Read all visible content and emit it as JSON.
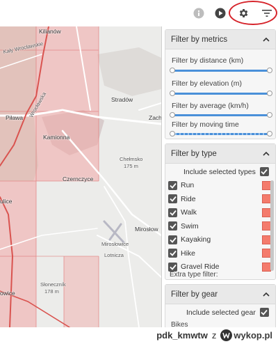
{
  "toolbar": {
    "icons": [
      "info-icon",
      "play-icon",
      "gear-icon",
      "filter-icon"
    ]
  },
  "map": {
    "labels": {
      "kilianow": "Kilianów",
      "kaly": "Kały Wrocławskie",
      "wroclawska": "Wrocławska",
      "pilawa": "Piława",
      "kamionna": "Kamionna",
      "stradow": "Stradów",
      "zach": "Zach",
      "chelmsko": "Chełmsko",
      "chelmsko_elev": "175 m",
      "czernczyce": "Czernczyce",
      "ulice": "ulice",
      "mirostowice_airport": "Mirosłowice",
      "mirostowice": "Mirosłow",
      "lotnicza": "Lotnicza",
      "sloneczník": "Słoneczník",
      "sloneczník_elev": "178 m",
      "owice": "owice"
    }
  },
  "filters": {
    "metrics": {
      "title": "Filter by metrics",
      "items": [
        {
          "label": "Filter by distance (km)"
        },
        {
          "label": "Filter by elevation (m)"
        },
        {
          "label": "Filter by average (km/h)"
        },
        {
          "label": "Filter by moving time"
        }
      ]
    },
    "type": {
      "title": "Filter by type",
      "include_label": "Include selected types",
      "include_checked": true,
      "items": [
        {
          "label": "Run",
          "checked": true,
          "color": "#f47b6c"
        },
        {
          "label": "Ride",
          "checked": true,
          "color": "#f47b6c"
        },
        {
          "label": "Walk",
          "checked": true,
          "color": "#f47b6c"
        },
        {
          "label": "Swim",
          "checked": true,
          "color": "#f47b6c"
        },
        {
          "label": "Kayaking",
          "checked": true,
          "color": "#f47b6c"
        },
        {
          "label": "Hike",
          "checked": true,
          "color": "#f47b6c"
        },
        {
          "label": "Gravel Ride",
          "checked": true,
          "color": "#f47b6c"
        }
      ],
      "extra_label": "Extra type filter:"
    },
    "gear": {
      "title": "Filter by gear",
      "include_label": "Include selected gear",
      "include_checked": true,
      "group_label": "Bikes"
    }
  },
  "watermark": {
    "user": "pdk_kmwtw",
    "separator": "z",
    "site": "wykop.pl"
  },
  "colors": {
    "accent": "#4a90d9",
    "swatch": "#f47b6c",
    "highlight": "#d6242b"
  }
}
